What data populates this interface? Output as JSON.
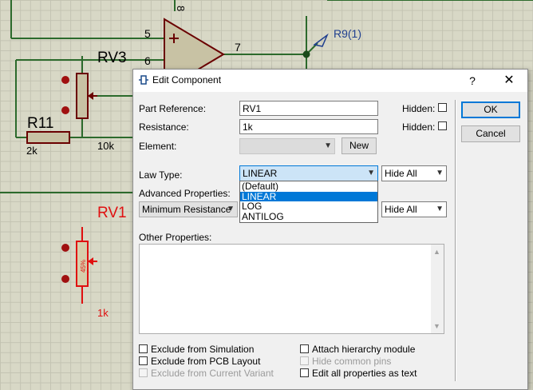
{
  "schematic": {
    "pin_5": "5",
    "pin_6": "6",
    "pin_7": "7",
    "pin_8": "8",
    "rv3_label": "RV3",
    "r11_label": "R11",
    "r11_value": "2k",
    "rv3_value": "10k",
    "r9_label": "R9(1)",
    "rv1_label": "RV1",
    "rv1_value": "1k",
    "rv1_percent": "45%",
    "wire_color": "#2c6a2c",
    "component_color": "#8b0000",
    "active_color": "#e01010",
    "opamp_fill": "#c8c2a4"
  },
  "dialog": {
    "title": "Edit Component",
    "help_glyph": "?",
    "close_glyph": "✕",
    "part_reference_label": "Part Reference:",
    "part_reference_value": "RV1",
    "resistance_label": "Resistance:",
    "resistance_value": "1k",
    "element_label": "Element:",
    "element_value": "",
    "new_button": "New",
    "hidden_label": "Hidden:",
    "law_type_label": "Law Type:",
    "law_type_value": "LINEAR",
    "law_type_options": [
      "(Default)",
      "LINEAR",
      "LOG",
      "ANTILOG"
    ],
    "law_type_highlighted": "LINEAR",
    "hide_all_1": "Hide All",
    "advanced_properties_label": "Advanced Properties:",
    "advanced_property_value": "Minimum Resistance",
    "hide_all_2": "Hide All",
    "other_properties_label": "Other Properties:",
    "ok_button": "OK",
    "cancel_button": "Cancel",
    "checkboxes": {
      "exclude_simulation": "Exclude from Simulation",
      "exclude_pcb": "Exclude from PCB Layout",
      "exclude_variant": "Exclude from Current Variant",
      "attach_hierarchy": "Attach hierarchy module",
      "hide_common_pins": "Hide common pins",
      "edit_all_text": "Edit all properties as text"
    }
  }
}
